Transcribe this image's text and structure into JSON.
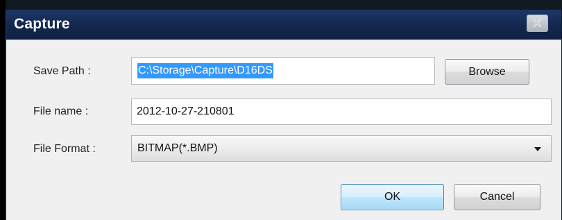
{
  "dialog": {
    "title": "Capture",
    "close_icon": "close-icon"
  },
  "fields": {
    "save_path": {
      "label": "Save Path :",
      "value": "C:\\Storage\\Capture\\D16DS"
    },
    "file_name": {
      "label": "File name :",
      "value": "2012-10-27-210801"
    },
    "file_format": {
      "label": "File Format :",
      "selected": "BITMAP(*.BMP)"
    }
  },
  "buttons": {
    "browse": "Browse",
    "ok": "OK",
    "cancel": "Cancel"
  },
  "colors": {
    "titlebar": "#13284e",
    "selection": "#3399ff",
    "ok_focus": "#bee6fd"
  }
}
